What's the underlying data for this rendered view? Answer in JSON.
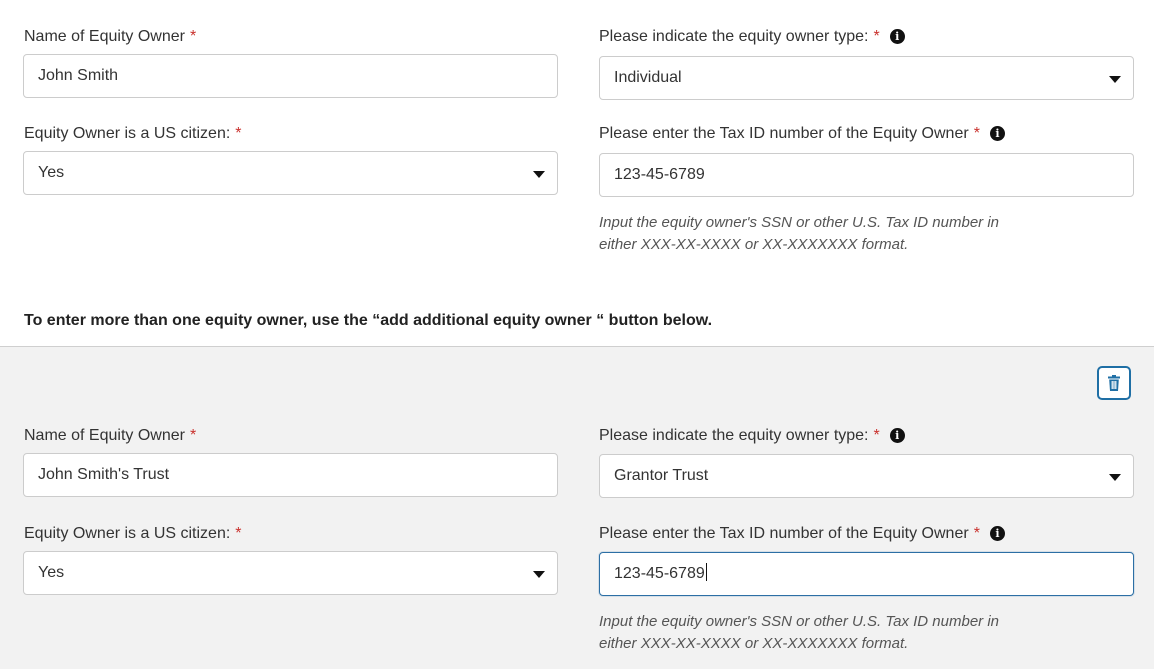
{
  "owners": [
    {
      "name_label": "Name of Equity Owner",
      "name_value": "John Smith",
      "type_label": "Please indicate the equity owner type:",
      "type_value": "Individual",
      "citizen_label": "Equity Owner is a US citizen:",
      "citizen_value": "Yes",
      "taxid_label": "Please enter the Tax ID number of the Equity Owner",
      "taxid_value": "123-45-6789",
      "taxid_help_1": "Input the equity owner's  SSN or other U.S. Tax ID number in",
      "taxid_help_2": "either XXX-XX-XXXX or XX-XXXXXXX format."
    },
    {
      "name_label": "Name of Equity Owner",
      "name_value": "John Smith's Trust",
      "type_label": "Please indicate the equity owner type:",
      "type_value": "Grantor Trust",
      "citizen_label": "Equity Owner is a US citizen:",
      "citizen_value": "Yes",
      "taxid_label": "Please enter the Tax ID number of the Equity Owner",
      "taxid_value": "123-45-6789",
      "taxid_help_1": "Input the equity owner's  SSN or other U.S. Tax ID number in",
      "taxid_help_2": "either XXX-XX-XXXX or XX-XXXXXXX format."
    }
  ],
  "required_mark": "*",
  "info_glyph": "i",
  "additional_note": "To enter more than one equity owner, use the “add additional equity owner “ button below.",
  "icons": {
    "info": "info-circle-icon",
    "delete": "trash-icon",
    "caret": "caret-down-icon"
  },
  "colors": {
    "required": "#c9302c",
    "accent": "#1f6fa5",
    "section_bg": "#f2f2f2"
  }
}
